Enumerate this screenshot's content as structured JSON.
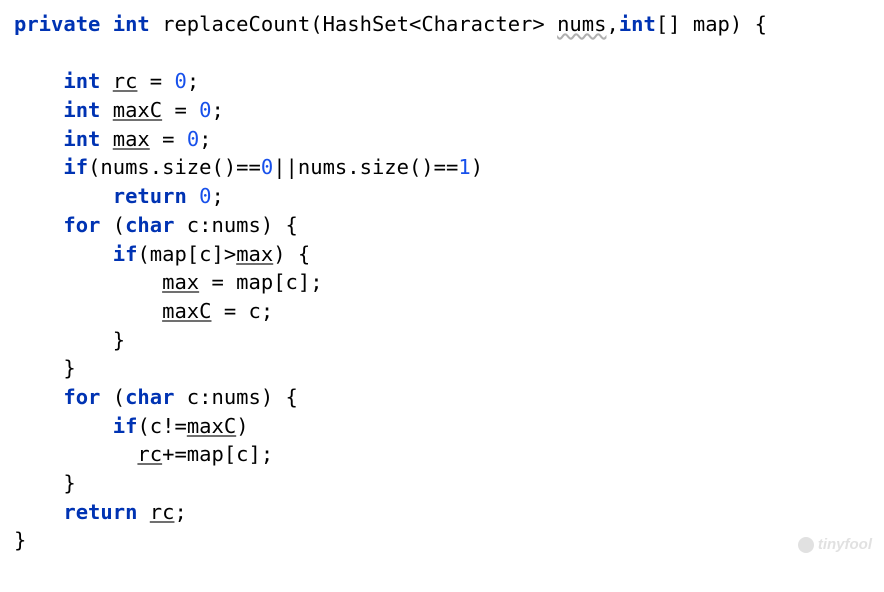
{
  "code": {
    "line1": {
      "kw_private": "private",
      "kw_int": "int",
      "method": "replaceCount",
      "open_paren": "(",
      "type": "HashSet<Character>",
      "param1": "nums",
      "comma": ",",
      "arrtype": "int",
      "arr": "[] ",
      "param2": "map",
      "close": ") {"
    },
    "line2": {
      "kw_int": "int",
      "var": "rc",
      "eq": " = ",
      "val": "0",
      "semi": ";"
    },
    "line3": {
      "kw_int": "int",
      "var": "maxC",
      "eq": " = ",
      "val": "0",
      "semi": ";"
    },
    "line4": {
      "kw_int": "int",
      "var": "max",
      "eq": " = ",
      "val": "0",
      "semi": ";"
    },
    "line5": {
      "kw_if": "if",
      "open": "(",
      "call1": "nums.size()==",
      "z1": "0",
      "or": "||",
      "call2": "nums.size()==",
      "z2": "1",
      "close": ")"
    },
    "line6": {
      "kw_return": "return",
      "val": "0",
      "semi": ";"
    },
    "line7": {
      "kw_for": "for",
      "open": " (",
      "kw_char": "char",
      "loopvar": " c:nums) {"
    },
    "line8": {
      "kw_if": "if",
      "open": "(",
      "arr": "map[c]>",
      "var": "max",
      "close": ") {"
    },
    "line9": {
      "var": "max",
      "rest": " = map[c];"
    },
    "line10": {
      "var": "maxC",
      "rest": " = c;"
    },
    "line11": {
      "brace": "}"
    },
    "line12": {
      "brace": "}"
    },
    "line13": {
      "kw_for": "for",
      "open": " (",
      "kw_char": "char",
      "loopvar": " c:nums) {"
    },
    "line14": {
      "kw_if": "if",
      "open": "(c!=",
      "var": "maxC",
      "close": ")"
    },
    "line15": {
      "var": "rc",
      "rest": "+=map[c];"
    },
    "line16": {
      "brace": "}"
    },
    "line17": {
      "kw_return": "return",
      "var": "rc",
      "semi": ";"
    },
    "line18": {
      "brace": "}"
    }
  },
  "watermark": "tinyfool"
}
